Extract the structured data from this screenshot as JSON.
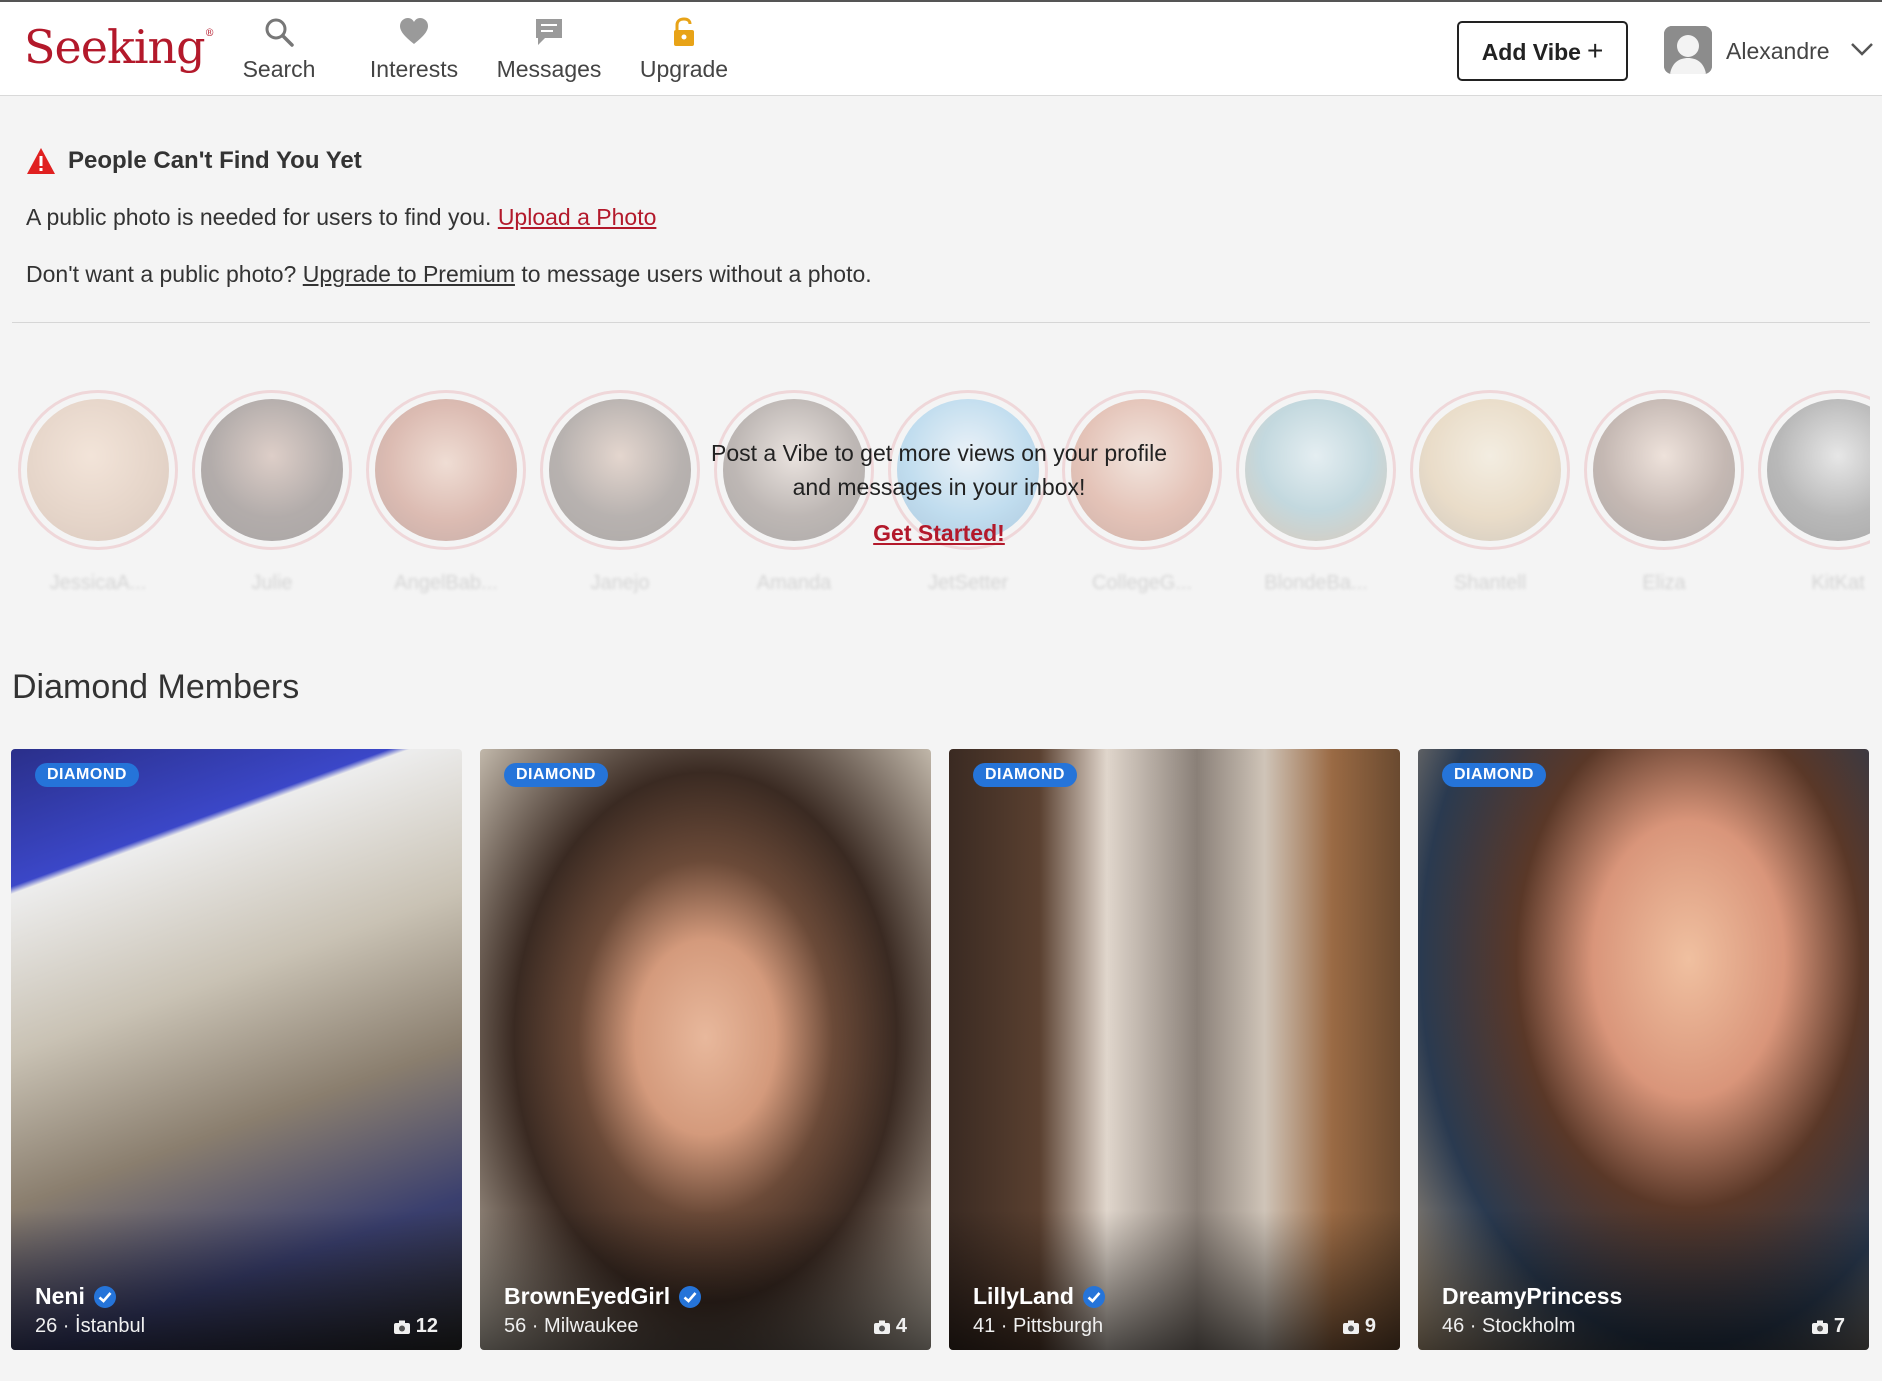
{
  "header": {
    "logo": "Seeking",
    "nav": [
      {
        "label": "Search",
        "icon": "search-icon"
      },
      {
        "label": "Interests",
        "icon": "heart-icon"
      },
      {
        "label": "Messages",
        "icon": "chat-icon"
      },
      {
        "label": "Upgrade",
        "icon": "unlock-icon"
      }
    ],
    "add_vibe_label": "Add Vibe",
    "add_vibe_plus": "+",
    "user_name": "Alexandre"
  },
  "alert": {
    "title": "People Can't Find You Yet",
    "line1_text": "A public photo is needed for users to find you.",
    "line1_link": "Upload a Photo",
    "line2_prefix": "Don't want a public photo?",
    "line2_link": "Upgrade to Premium",
    "line2_suffix": "to message users without a photo."
  },
  "vibes": {
    "cta_line1": "Post a Vibe to get more views on your profile",
    "cta_line2": "and messages in your inbox!",
    "cta_link": "Get Started!",
    "users": [
      "JessicaA...",
      "Julie",
      "AngelBab...",
      "Janejo",
      "Amanda",
      "JetSetter",
      "CollegeG...",
      "BlondeBa...",
      "Shantell",
      "Eliza",
      "KitKat"
    ]
  },
  "diamond": {
    "title": "Diamond Members",
    "badge": "DIAMOND",
    "members": [
      {
        "name": "Neni",
        "age": "26",
        "city": "İstanbul",
        "photos": "12",
        "verified": true
      },
      {
        "name": "BrownEyedGirl",
        "age": "56",
        "city": "Milwaukee",
        "photos": "4",
        "verified": true
      },
      {
        "name": "LillyLand",
        "age": "41",
        "city": "Pittsburgh",
        "photos": "9",
        "verified": true
      },
      {
        "name": "DreamyPrincess",
        "age": "46",
        "city": "Stockholm",
        "photos": "7",
        "verified": false
      }
    ]
  },
  "colors": {
    "brand": "#b3192b",
    "badge": "#2574d9",
    "upgrade_icon": "#e8a317",
    "warning": "#e02020"
  }
}
